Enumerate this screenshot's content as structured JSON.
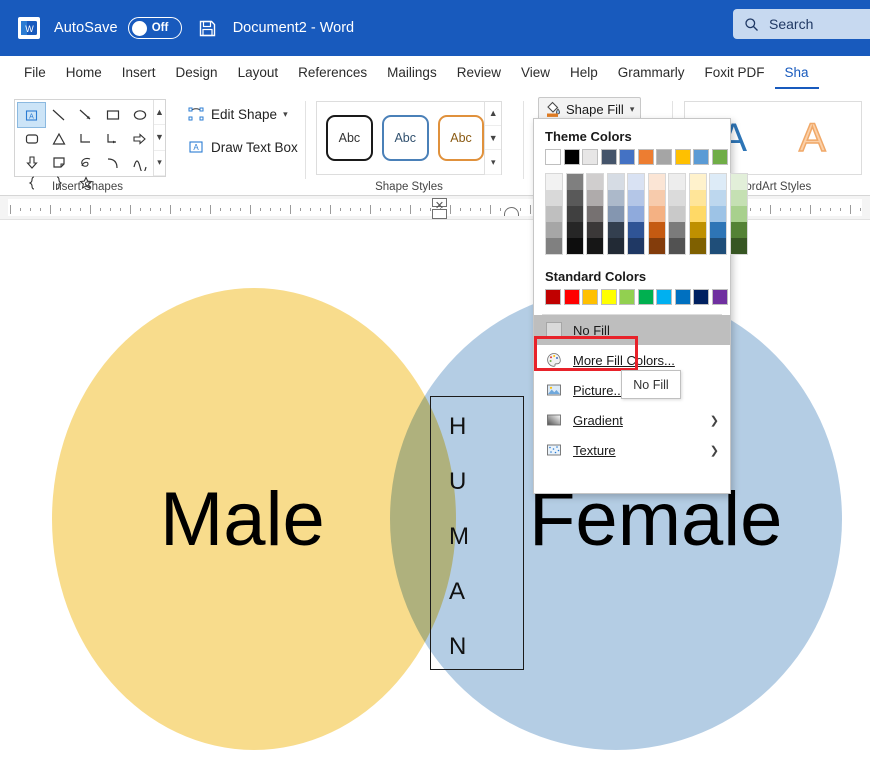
{
  "titlebar": {
    "app_icon": "word-logo-icon",
    "autosave_label": "AutoSave",
    "autosave_state": "Off",
    "save_icon": "save-disk-icon",
    "document_title": "Document2  -  Word",
    "search_icon": "search-icon",
    "search_placeholder": "Search",
    "background_color": "#185ABD"
  },
  "tabs": [
    {
      "label": "File",
      "active": false
    },
    {
      "label": "Home",
      "active": false
    },
    {
      "label": "Insert",
      "active": false
    },
    {
      "label": "Design",
      "active": false
    },
    {
      "label": "Layout",
      "active": false
    },
    {
      "label": "References",
      "active": false
    },
    {
      "label": "Mailings",
      "active": false
    },
    {
      "label": "Review",
      "active": false
    },
    {
      "label": "View",
      "active": false
    },
    {
      "label": "Help",
      "active": false
    },
    {
      "label": "Grammarly",
      "active": false
    },
    {
      "label": "Foxit PDF",
      "active": false
    },
    {
      "label": "Sha",
      "active": true
    }
  ],
  "ribbon": {
    "groups": [
      {
        "name": "insert-shapes",
        "label": "Insert Shapes"
      },
      {
        "name": "shape-styles",
        "label": "Shape Styles"
      },
      {
        "name": "wordart-styles",
        "label": "WordArt Styles"
      }
    ],
    "insert_shapes": {
      "edit_shape_label": "Edit Shape",
      "draw_text_box_label": "Draw Text Box",
      "shape_icons": [
        "text-box-shape-icon",
        "line-shape-icon",
        "line-arrow-shape-icon",
        "rectangle-shape-icon",
        "oval-shape-icon",
        "rounded-rectangle-shape-icon",
        "triangle-shape-icon",
        "elbow-connector-shape-icon",
        "elbow-arrow-connector-shape-icon",
        "right-arrow-shape-icon",
        "down-arrow-shape-icon",
        "folded-corner-shape-icon",
        "scribble-shape-icon",
        "arc-shape-icon",
        "curve-shape-icon",
        "left-brace-shape-icon",
        "right-brace-shape-icon",
        "star-shape-icon"
      ]
    },
    "shape_styles": {
      "samples": [
        {
          "label": "Abc",
          "variant": "k"
        },
        {
          "label": "Abc",
          "variant": "b"
        },
        {
          "label": "Abc",
          "variant": "o"
        }
      ]
    },
    "wordart_styles": {
      "samples": [
        {
          "label": "A",
          "variant": "blue"
        },
        {
          "label": "A",
          "variant": "orange"
        }
      ]
    },
    "shape_fill_button": {
      "label": "Shape Fill",
      "icon": "paint-bucket-icon",
      "chevron": "chevron-down-icon"
    }
  },
  "fill_menu": {
    "theme_colors_heading": "Theme Colors",
    "theme_colors": [
      "#FFFFFF",
      "#000000",
      "#E7E6E6",
      "#44546A",
      "#4472C4",
      "#ED7D31",
      "#A5A5A5",
      "#FFC000",
      "#5B9BD5",
      "#70AD47"
    ],
    "theme_variants": [
      [
        "#F2F2F2",
        "#D9D9D9",
        "#BFBFBF",
        "#A6A6A6",
        "#808080"
      ],
      [
        "#7F7F7F",
        "#595959",
        "#404040",
        "#262626",
        "#0D0D0D"
      ],
      [
        "#D0CECE",
        "#AFABAB",
        "#767171",
        "#3B3838",
        "#161616"
      ],
      [
        "#D6DCE4",
        "#ACB9CA",
        "#8496B0",
        "#333F4F",
        "#222A35"
      ],
      [
        "#D9E2F3",
        "#B4C6E7",
        "#8FAADC",
        "#2F5496",
        "#1F3864"
      ],
      [
        "#FBE5D5",
        "#F7CBAC",
        "#F4B183",
        "#C55A11",
        "#833C0B"
      ],
      [
        "#EDEDED",
        "#DBDBDB",
        "#C9C9C9",
        "#7B7B7B",
        "#525252"
      ],
      [
        "#FFF2CC",
        "#FFE599",
        "#FFD966",
        "#BF9000",
        "#7F6000"
      ],
      [
        "#DDEBF7",
        "#BDD7EE",
        "#9DC3E6",
        "#2E75B6",
        "#1F4E79"
      ],
      [
        "#E2EFD9",
        "#C5E0B3",
        "#A8D08D",
        "#548235",
        "#375623"
      ]
    ],
    "standard_colors_heading": "Standard Colors",
    "standard_colors": [
      "#C00000",
      "#FF0000",
      "#FFC000",
      "#FFFF00",
      "#92D050",
      "#00B050",
      "#00B0F0",
      "#0070C0",
      "#002060",
      "#7030A0"
    ],
    "items": [
      {
        "label": "No Fill",
        "icon": "no-fill-swatch-icon",
        "highlighted": true,
        "submenu": false
      },
      {
        "label": "More Fill Colors...",
        "icon": "palette-icon",
        "highlighted": false,
        "submenu": false
      },
      {
        "label": "Picture...",
        "icon": "picture-icon",
        "highlighted": false,
        "submenu": false
      },
      {
        "label": "Gradient",
        "icon": "gradient-icon",
        "highlighted": false,
        "submenu": true
      },
      {
        "label": "Texture",
        "icon": "texture-icon",
        "highlighted": false,
        "submenu": true
      }
    ],
    "annotation_color": "#E8222A",
    "tooltip_text": "No Fill"
  },
  "document": {
    "venn": {
      "left_circle": {
        "label": "Male",
        "color": "#F8DC8C"
      },
      "right_circle": {
        "label": "Female",
        "color": "#B4CDE4"
      },
      "overlap_color": "#B5C6AE",
      "center_textbox": {
        "letters": [
          "H",
          "U",
          "M",
          "A",
          "N"
        ],
        "border_color": "#1A1A1A"
      }
    }
  }
}
